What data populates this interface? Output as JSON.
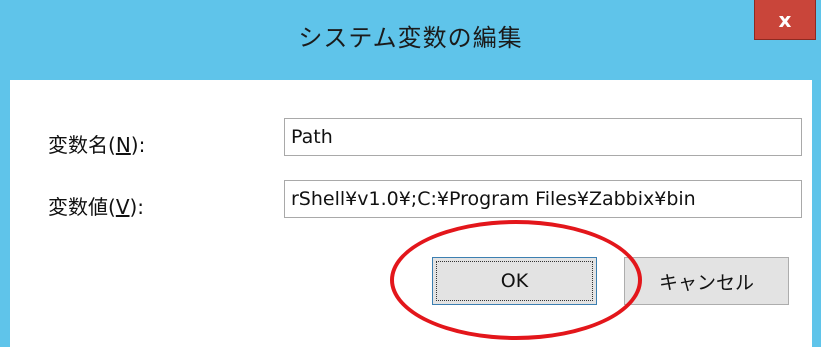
{
  "window": {
    "title": "システム変数の編集",
    "close_glyph": "x",
    "titlebar_color": "#5fc4ea",
    "close_color": "#c9453a"
  },
  "form": {
    "name_label_prefix": "変数名(",
    "name_label_accel": "N",
    "name_label_suffix": "):",
    "name_value": "Path",
    "value_label_prefix": "変数値(",
    "value_label_accel": "V",
    "value_label_suffix": "):",
    "value_value": "rShell¥v1.0¥;C:¥Program Files¥Zabbix¥bin"
  },
  "buttons": {
    "ok_label": "OK",
    "cancel_label": "キャンセル"
  },
  "annotation": {
    "highlight_color": "#e3161b",
    "shape": "red ellipse around OK button"
  }
}
